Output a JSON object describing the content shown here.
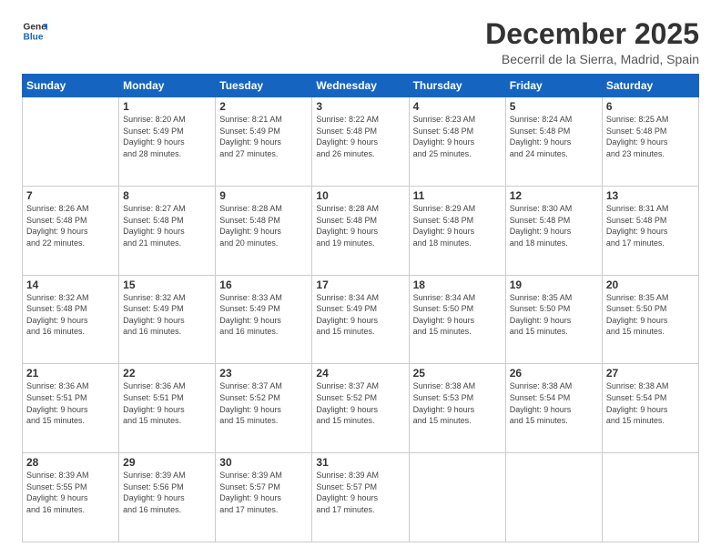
{
  "logo": {
    "line1": "General",
    "line2": "Blue"
  },
  "title": "December 2025",
  "subtitle": "Becerril de la Sierra, Madrid, Spain",
  "days_of_week": [
    "Sunday",
    "Monday",
    "Tuesday",
    "Wednesday",
    "Thursday",
    "Friday",
    "Saturday"
  ],
  "weeks": [
    [
      {
        "day": "",
        "info": ""
      },
      {
        "day": "1",
        "info": "Sunrise: 8:20 AM\nSunset: 5:49 PM\nDaylight: 9 hours\nand 28 minutes."
      },
      {
        "day": "2",
        "info": "Sunrise: 8:21 AM\nSunset: 5:49 PM\nDaylight: 9 hours\nand 27 minutes."
      },
      {
        "day": "3",
        "info": "Sunrise: 8:22 AM\nSunset: 5:48 PM\nDaylight: 9 hours\nand 26 minutes."
      },
      {
        "day": "4",
        "info": "Sunrise: 8:23 AM\nSunset: 5:48 PM\nDaylight: 9 hours\nand 25 minutes."
      },
      {
        "day": "5",
        "info": "Sunrise: 8:24 AM\nSunset: 5:48 PM\nDaylight: 9 hours\nand 24 minutes."
      },
      {
        "day": "6",
        "info": "Sunrise: 8:25 AM\nSunset: 5:48 PM\nDaylight: 9 hours\nand 23 minutes."
      }
    ],
    [
      {
        "day": "7",
        "info": "Sunrise: 8:26 AM\nSunset: 5:48 PM\nDaylight: 9 hours\nand 22 minutes."
      },
      {
        "day": "8",
        "info": "Sunrise: 8:27 AM\nSunset: 5:48 PM\nDaylight: 9 hours\nand 21 minutes."
      },
      {
        "day": "9",
        "info": "Sunrise: 8:28 AM\nSunset: 5:48 PM\nDaylight: 9 hours\nand 20 minutes."
      },
      {
        "day": "10",
        "info": "Sunrise: 8:28 AM\nSunset: 5:48 PM\nDaylight: 9 hours\nand 19 minutes."
      },
      {
        "day": "11",
        "info": "Sunrise: 8:29 AM\nSunset: 5:48 PM\nDaylight: 9 hours\nand 18 minutes."
      },
      {
        "day": "12",
        "info": "Sunrise: 8:30 AM\nSunset: 5:48 PM\nDaylight: 9 hours\nand 18 minutes."
      },
      {
        "day": "13",
        "info": "Sunrise: 8:31 AM\nSunset: 5:48 PM\nDaylight: 9 hours\nand 17 minutes."
      }
    ],
    [
      {
        "day": "14",
        "info": "Sunrise: 8:32 AM\nSunset: 5:48 PM\nDaylight: 9 hours\nand 16 minutes."
      },
      {
        "day": "15",
        "info": "Sunrise: 8:32 AM\nSunset: 5:49 PM\nDaylight: 9 hours\nand 16 minutes."
      },
      {
        "day": "16",
        "info": "Sunrise: 8:33 AM\nSunset: 5:49 PM\nDaylight: 9 hours\nand 16 minutes."
      },
      {
        "day": "17",
        "info": "Sunrise: 8:34 AM\nSunset: 5:49 PM\nDaylight: 9 hours\nand 15 minutes."
      },
      {
        "day": "18",
        "info": "Sunrise: 8:34 AM\nSunset: 5:50 PM\nDaylight: 9 hours\nand 15 minutes."
      },
      {
        "day": "19",
        "info": "Sunrise: 8:35 AM\nSunset: 5:50 PM\nDaylight: 9 hours\nand 15 minutes."
      },
      {
        "day": "20",
        "info": "Sunrise: 8:35 AM\nSunset: 5:50 PM\nDaylight: 9 hours\nand 15 minutes."
      }
    ],
    [
      {
        "day": "21",
        "info": "Sunrise: 8:36 AM\nSunset: 5:51 PM\nDaylight: 9 hours\nand 15 minutes."
      },
      {
        "day": "22",
        "info": "Sunrise: 8:36 AM\nSunset: 5:51 PM\nDaylight: 9 hours\nand 15 minutes."
      },
      {
        "day": "23",
        "info": "Sunrise: 8:37 AM\nSunset: 5:52 PM\nDaylight: 9 hours\nand 15 minutes."
      },
      {
        "day": "24",
        "info": "Sunrise: 8:37 AM\nSunset: 5:52 PM\nDaylight: 9 hours\nand 15 minutes."
      },
      {
        "day": "25",
        "info": "Sunrise: 8:38 AM\nSunset: 5:53 PM\nDaylight: 9 hours\nand 15 minutes."
      },
      {
        "day": "26",
        "info": "Sunrise: 8:38 AM\nSunset: 5:54 PM\nDaylight: 9 hours\nand 15 minutes."
      },
      {
        "day": "27",
        "info": "Sunrise: 8:38 AM\nSunset: 5:54 PM\nDaylight: 9 hours\nand 15 minutes."
      }
    ],
    [
      {
        "day": "28",
        "info": "Sunrise: 8:39 AM\nSunset: 5:55 PM\nDaylight: 9 hours\nand 16 minutes."
      },
      {
        "day": "29",
        "info": "Sunrise: 8:39 AM\nSunset: 5:56 PM\nDaylight: 9 hours\nand 16 minutes."
      },
      {
        "day": "30",
        "info": "Sunrise: 8:39 AM\nSunset: 5:57 PM\nDaylight: 9 hours\nand 17 minutes."
      },
      {
        "day": "31",
        "info": "Sunrise: 8:39 AM\nSunset: 5:57 PM\nDaylight: 9 hours\nand 17 minutes."
      },
      {
        "day": "",
        "info": ""
      },
      {
        "day": "",
        "info": ""
      },
      {
        "day": "",
        "info": ""
      }
    ]
  ]
}
